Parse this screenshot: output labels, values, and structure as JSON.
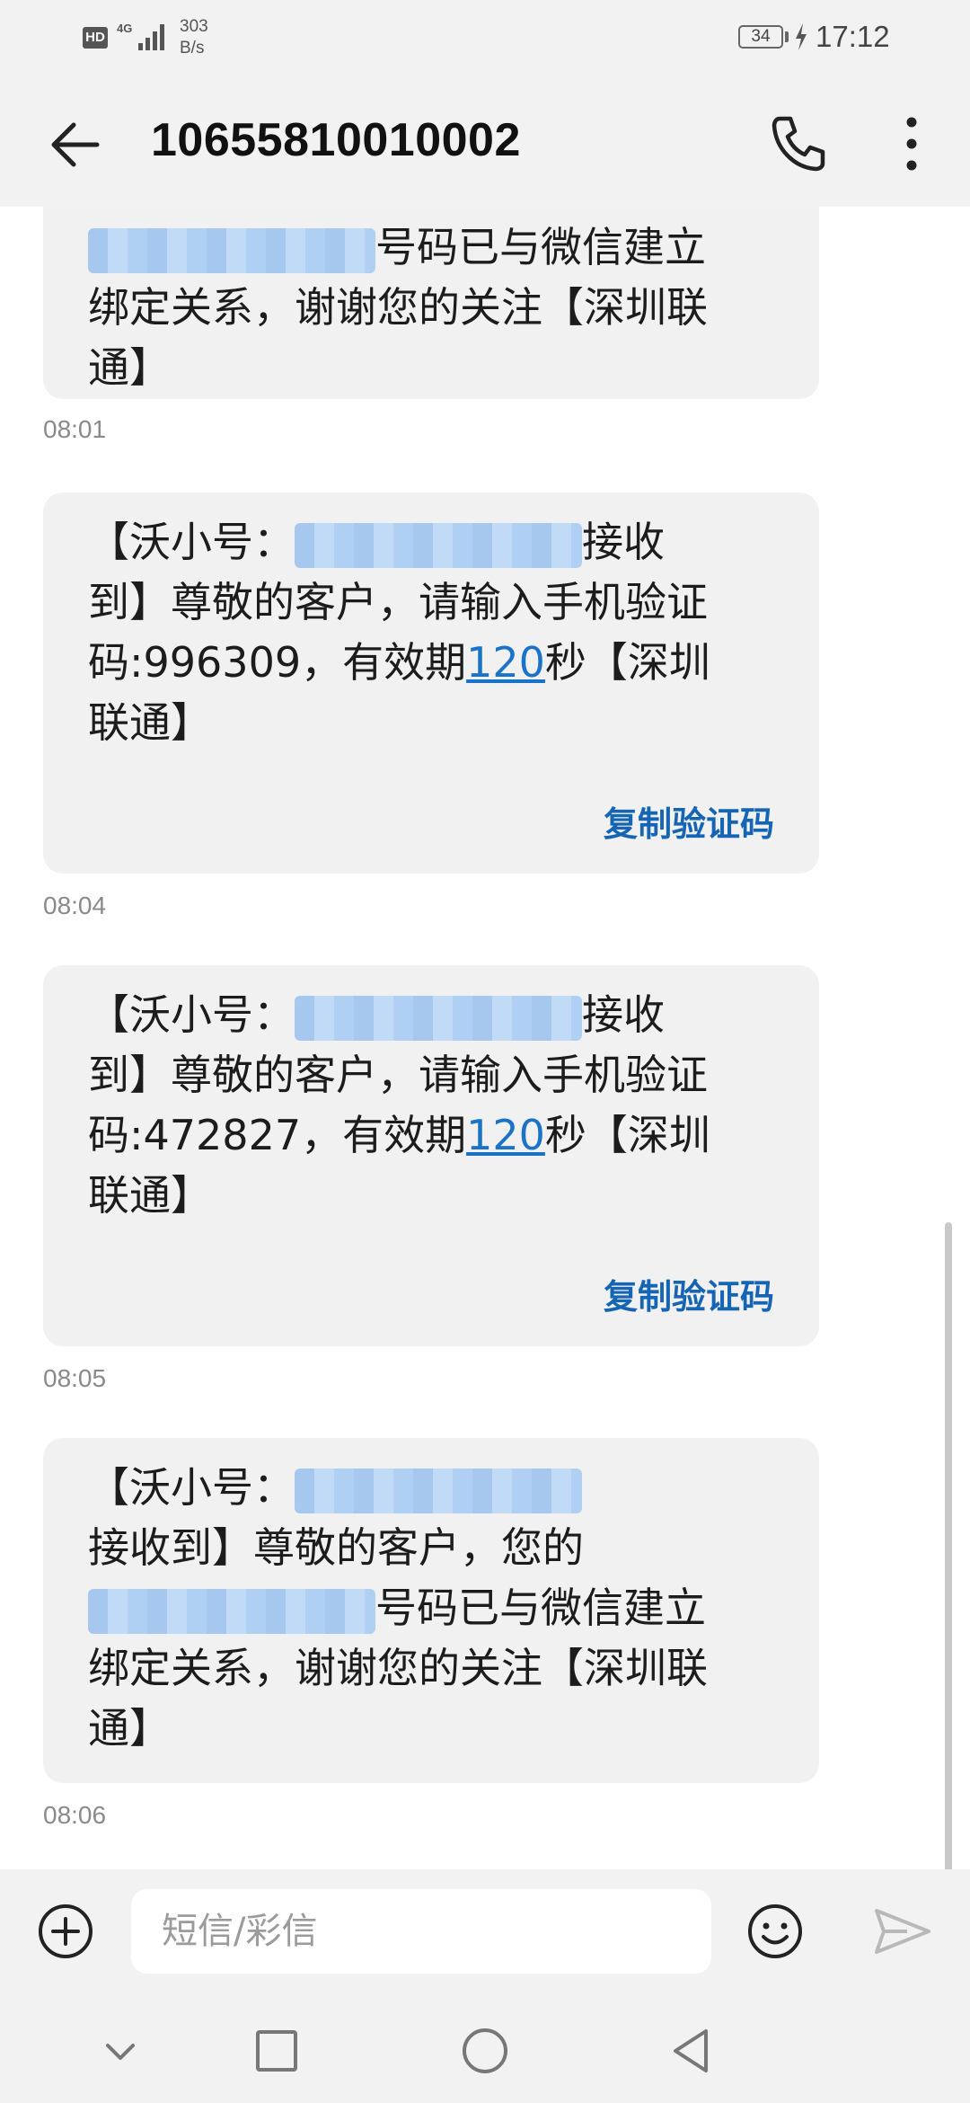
{
  "status_bar": {
    "hd_badge": "HD",
    "network": "4G",
    "speed_value": "303",
    "speed_unit": "B/s",
    "battery": "34",
    "time": "17:12"
  },
  "header": {
    "back_icon": "arrow-left-icon",
    "contact_number": "10655810010002",
    "call_icon": "phone-icon",
    "more_icon": "more-vertical-icon"
  },
  "messages": [
    {
      "text_after_redact": "号码已与微信建立绑定关系，谢谢您的关注【深圳联通】",
      "line2": "绑定关系，谢谢您的关注【深圳联",
      "line3": "通】",
      "line1_suffix": "号码已与微信建立",
      "time": "08:01"
    },
    {
      "line1_prefix": "【沃小号：",
      "line1_suffix": "接收",
      "line2": "到】尊敬的客户，请输入手机验证",
      "line3_prefix": "码:996309，有效期",
      "link": "120",
      "line3_suffix": "秒【深圳",
      "line4": "联通】",
      "copy_label": "复制验证码",
      "time": "08:04"
    },
    {
      "line1_prefix": "【沃小号：",
      "line1_suffix": "接收",
      "line2": "到】尊敬的客户，请输入手机验证",
      "line3_prefix": "码:472827，有效期",
      "link": "120",
      "line3_suffix": "秒【深圳",
      "line4": "联通】",
      "copy_label": "复制验证码",
      "time": "08:05"
    },
    {
      "line1_prefix": "【沃小号：",
      "line2": "接收到】尊敬的客户，您的",
      "line3_suffix": "号码已与微信建立",
      "line4": "绑定关系，谢谢您的关注【深圳联",
      "line5": "通】",
      "time": "08:06"
    }
  ],
  "composer": {
    "add_icon": "plus-circle-icon",
    "placeholder": "短信/彩信",
    "emoji_icon": "emoji-icon",
    "send_icon": "send-icon"
  },
  "nav": {
    "items": [
      "chevron-down-icon",
      "square-icon",
      "circle-icon",
      "triangle-back-icon"
    ]
  }
}
